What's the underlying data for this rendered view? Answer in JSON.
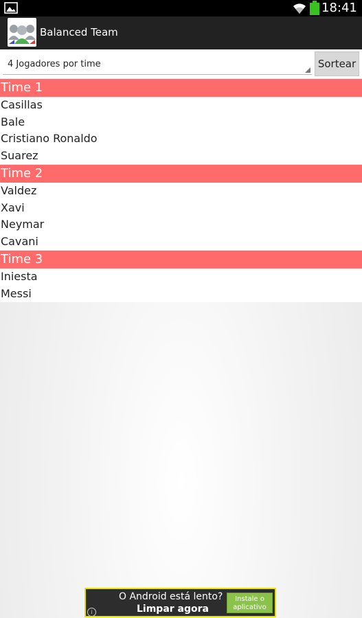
{
  "status_bar": {
    "time": "18:41",
    "icons": [
      "gallery-icon",
      "wifi-icon",
      "battery-icon"
    ],
    "battery_color": "#39c021"
  },
  "app_bar": {
    "title": "Balanced Team",
    "icon": "team-icon"
  },
  "controls": {
    "spinner_value": "4 Jogadores por time",
    "sort_button": "Sortear"
  },
  "teams": [
    {
      "name": "Time 1",
      "players": [
        "Casillas",
        "Bale",
        "Cristiano Ronaldo",
        "Suarez"
      ]
    },
    {
      "name": "Time 2",
      "players": [
        "Valdez",
        "Xavi",
        "Neymar",
        "Cavani"
      ]
    },
    {
      "name": "Time 3",
      "players": [
        "Iniesta",
        "Messi"
      ]
    }
  ],
  "colors": {
    "team_header": "#ff6a6a",
    "action_bar": "#222222",
    "ad_border": "#e8e000",
    "ad_button": "#8bc34a"
  },
  "ad": {
    "line1": "O Android está lento?",
    "line2": "Limpar agora",
    "button": "Instale o aplicativo",
    "info_icon": "info-icon"
  }
}
